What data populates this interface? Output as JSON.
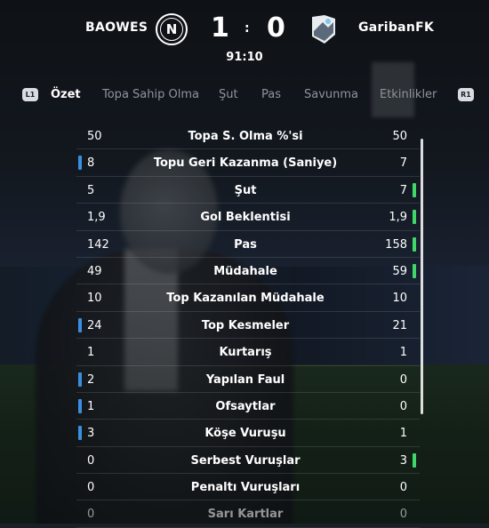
{
  "match": {
    "home_team": "BAOWES",
    "away_team": "GaribanFK",
    "home_crest_letter": "N",
    "home_score": "1",
    "away_score": "0",
    "separator": ":",
    "clock": "91:10"
  },
  "tabs": {
    "left_shoulder": "L1",
    "right_shoulder": "R1",
    "items": [
      "Özet",
      "Topa Sahip Olma",
      "Şut",
      "Pas",
      "Savunma",
      "Etkinlikler"
    ],
    "active": "Özet"
  },
  "stats": [
    {
      "label": "Topa S. Olma %'si",
      "home": "50",
      "away": "50",
      "lead": "none"
    },
    {
      "label": "Topu Geri Kazanma (Saniye)",
      "home": "8",
      "away": "7",
      "lead": "home"
    },
    {
      "label": "Şut",
      "home": "5",
      "away": "7",
      "lead": "away"
    },
    {
      "label": "Gol Beklentisi",
      "home": "1,9",
      "away": "1,9",
      "lead": "away"
    },
    {
      "label": "Pas",
      "home": "142",
      "away": "158",
      "lead": "away"
    },
    {
      "label": "Müdahale",
      "home": "49",
      "away": "59",
      "lead": "away"
    },
    {
      "label": "Top Kazanılan Müdahale",
      "home": "10",
      "away": "10",
      "lead": "none"
    },
    {
      "label": "Top Kesmeler",
      "home": "24",
      "away": "21",
      "lead": "home"
    },
    {
      "label": "Kurtarış",
      "home": "1",
      "away": "1",
      "lead": "none"
    },
    {
      "label": "Yapılan Faul",
      "home": "2",
      "away": "0",
      "lead": "home"
    },
    {
      "label": "Ofsaytlar",
      "home": "1",
      "away": "0",
      "lead": "home"
    },
    {
      "label": "Köşe Vuruşu",
      "home": "3",
      "away": "1",
      "lead": "home"
    },
    {
      "label": "Serbest Vuruşlar",
      "home": "0",
      "away": "3",
      "lead": "away"
    },
    {
      "label": "Penaltı Vuruşları",
      "home": "0",
      "away": "0",
      "lead": "none"
    },
    {
      "label": "Sarı Kartlar",
      "home": "0",
      "away": "0",
      "lead": "none"
    }
  ],
  "colors": {
    "home_lead": "#3b8fe0",
    "away_lead": "#3fd66a"
  }
}
